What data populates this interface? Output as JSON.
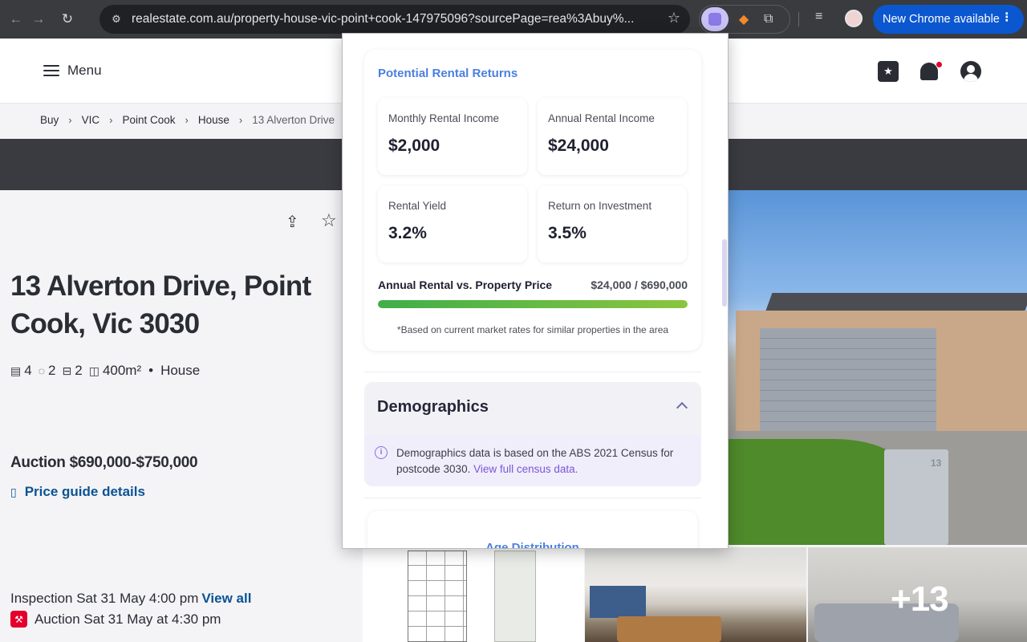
{
  "browser": {
    "url": "realestate.com.au/property-house-vic-point+cook-147975096?sourcePage=rea%3Abuy%...",
    "update_label": "New Chrome available"
  },
  "header": {
    "menu_label": "Menu"
  },
  "breadcrumb": [
    "Buy",
    "VIC",
    "Point Cook",
    "House",
    "13 Alverton Drive"
  ],
  "listing": {
    "address": "13 Alverton Drive, Point Cook, Vic 3030",
    "bedrooms": "4",
    "bathrooms": "2",
    "car_spaces": "2",
    "land_size": "400m²",
    "property_type": "House",
    "price": "Auction $690,000-$750,000",
    "price_guide_label": "Price guide details",
    "inspection_text": "Inspection Sat 31 May 4:00 pm",
    "view_all_label": "View all",
    "auction_text": "Auction Sat 31 May at 4:30 pm",
    "more_photos_label": "+13"
  },
  "rental": {
    "title": "Potential Rental Returns",
    "monthly_label": "Monthly Rental Income",
    "monthly_value": "$2,000",
    "annual_label": "Annual Rental Income",
    "annual_value": "$24,000",
    "yield_label": "Rental Yield",
    "yield_value": "3.2%",
    "roi_label": "Return on Investment",
    "roi_value": "3.5%",
    "compare_label": "Annual Rental vs. Property Price",
    "compare_value": "$24,000 / $690,000",
    "bar_fill_percent": 100,
    "footnote": "*Based on current market rates for similar properties in the area"
  },
  "demographics": {
    "title": "Demographics",
    "note": "Demographics data is based on the ABS 2021 Census for postcode 3030.",
    "link_label": "View full census data.",
    "age_title": "Age Distribution"
  },
  "colors": {
    "chrome_update": "#0b57d0",
    "link_blue": "#0b5394",
    "accent_blue": "#4a7fe0",
    "auction_red": "#e4002b",
    "bar_green": "#3fae49"
  }
}
